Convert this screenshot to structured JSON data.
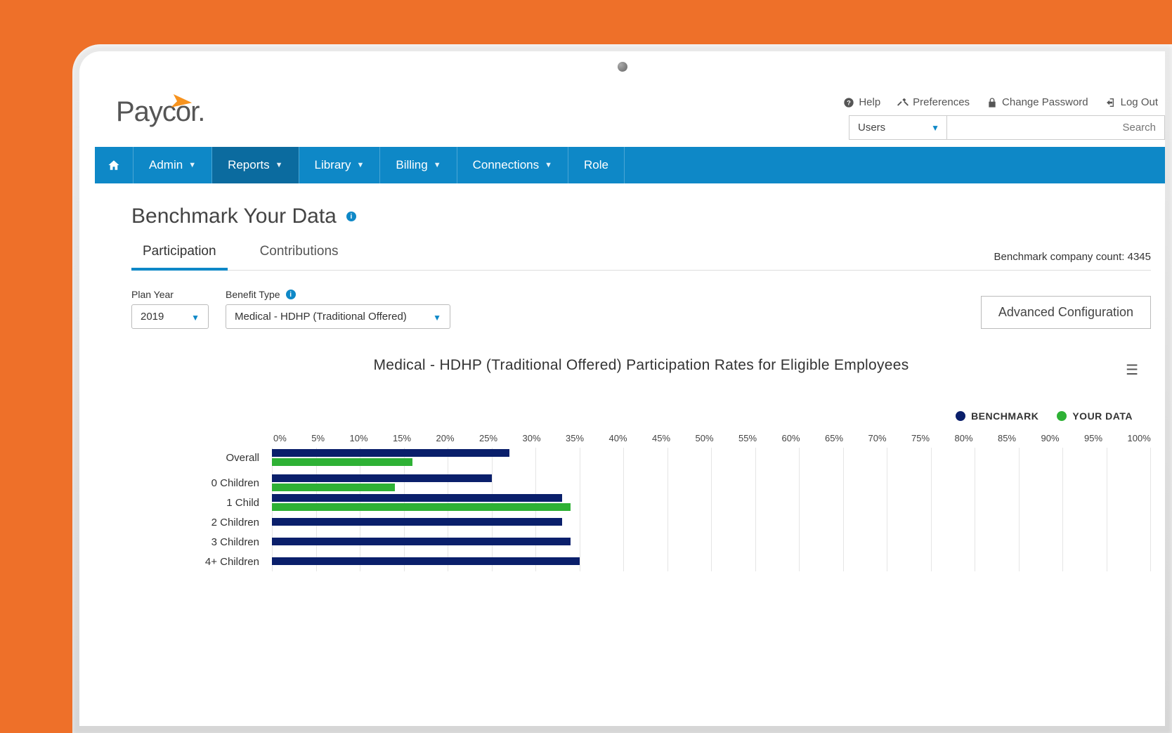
{
  "brand": "Paycor",
  "util_links": {
    "help": "Help",
    "preferences": "Preferences",
    "change_password": "Change Password",
    "log_out": "Log Out"
  },
  "search": {
    "dropdown_value": "Users",
    "placeholder": "Search"
  },
  "nav": {
    "admin": "Admin",
    "reports": "Reports",
    "library": "Library",
    "billing": "Billing",
    "connections": "Connections",
    "role": "Role"
  },
  "page_title": "Benchmark Your Data",
  "tabs": {
    "participation": "Participation",
    "contributions": "Contributions"
  },
  "benchmark_count_label": "Benchmark company count: 4345",
  "filters": {
    "plan_year_label": "Plan Year",
    "plan_year_value": "2019",
    "benefit_type_label": "Benefit Type",
    "benefit_type_value": "Medical - HDHP (Traditional Offered)"
  },
  "advanced_btn": "Advanced Configuration",
  "chart_title": "Medical - HDHP (Traditional Offered) Participation Rates for Eligible Employees",
  "legend": {
    "benchmark": "BENCHMARK",
    "your_data": "YOUR DATA"
  },
  "colors": {
    "benchmark": "#0a1f6b",
    "your_data": "#2eb135",
    "brand_blue": "#0e88c7",
    "brand_orange": "#f7931e"
  },
  "chart_data": {
    "type": "bar",
    "orientation": "horizontal",
    "title": "Medical - HDHP (Traditional Offered) Participation Rates for Eligible Employees",
    "xlabel": "",
    "ylabel": "",
    "xlim": [
      0,
      100
    ],
    "ticks": [
      "0%",
      "5%",
      "10%",
      "15%",
      "20%",
      "25%",
      "30%",
      "35%",
      "40%",
      "45%",
      "50%",
      "55%",
      "60%",
      "65%",
      "70%",
      "75%",
      "80%",
      "85%",
      "90%",
      "95%",
      "100%"
    ],
    "categories": [
      "Overall",
      "0 Children",
      "1 Child",
      "2 Children",
      "3 Children",
      "4+ Children"
    ],
    "series": [
      {
        "name": "BENCHMARK",
        "color": "#0a1f6b",
        "values": [
          27,
          25,
          33,
          33,
          34,
          35
        ]
      },
      {
        "name": "YOUR DATA",
        "color": "#2eb135",
        "values": [
          16,
          14,
          34,
          null,
          null,
          null
        ]
      }
    ]
  }
}
